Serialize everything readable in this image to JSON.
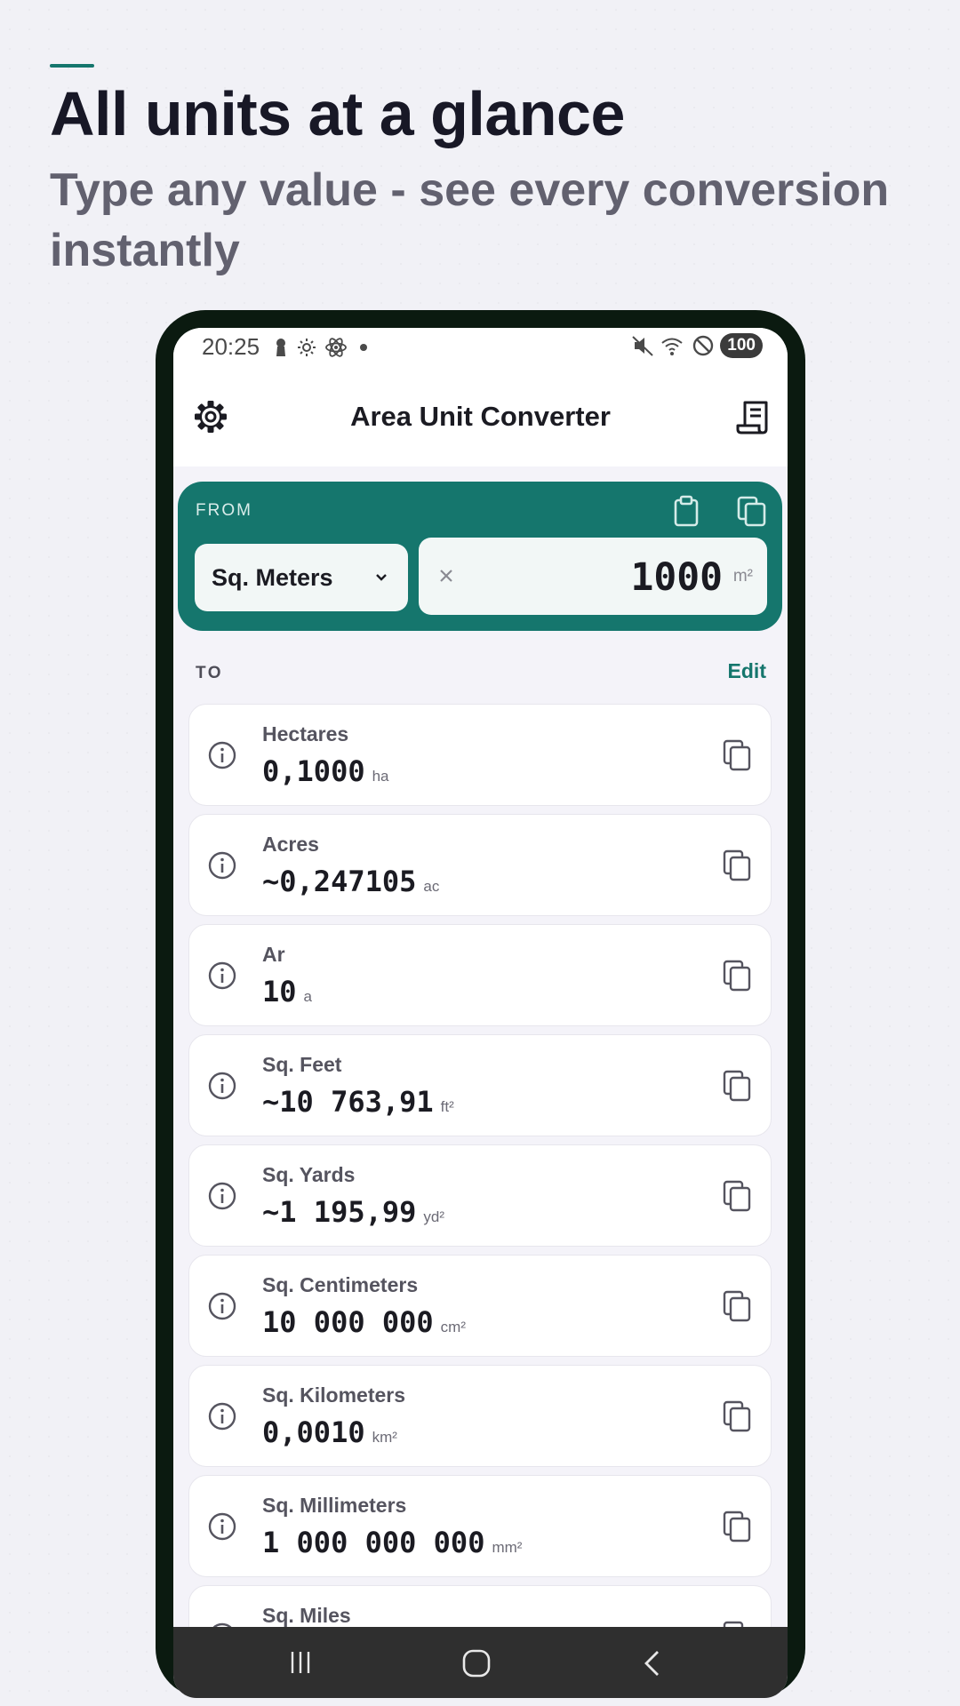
{
  "promo": {
    "headline": "All units at a glance",
    "subheadline": "Type any value - see every conversion instantly"
  },
  "status_bar": {
    "time": "20:25",
    "battery": "100"
  },
  "app_bar": {
    "title": "Area Unit Converter"
  },
  "from": {
    "label": "FROM",
    "selected_unit": "Sq. Meters",
    "value": "1000",
    "unit_symbol": "m²"
  },
  "to": {
    "label": "TO",
    "edit_label": "Edit",
    "results": [
      {
        "name": "Hectares",
        "value": "0,1000",
        "symbol": "ha"
      },
      {
        "name": "Acres",
        "value": "~0,247105",
        "symbol": "ac"
      },
      {
        "name": "Ar",
        "value": "10",
        "symbol": "a"
      },
      {
        "name": "Sq. Feet",
        "value": "~10 763,91",
        "symbol": "ft²"
      },
      {
        "name": "Sq. Yards",
        "value": "~1 195,99",
        "symbol": "yd²"
      },
      {
        "name": "Sq. Centimeters",
        "value": "10 000 000",
        "symbol": "cm²"
      },
      {
        "name": "Sq. Kilometers",
        "value": "0,0010",
        "symbol": "km²"
      },
      {
        "name": "Sq. Millimeters",
        "value": "1 000 000 000",
        "symbol": "mm²"
      },
      {
        "name": "Sq. Miles",
        "value": "",
        "symbol": ""
      }
    ]
  },
  "colors": {
    "accent": "#15766d",
    "device_frame": "#0b1a10",
    "background": "#f1f1f6"
  }
}
